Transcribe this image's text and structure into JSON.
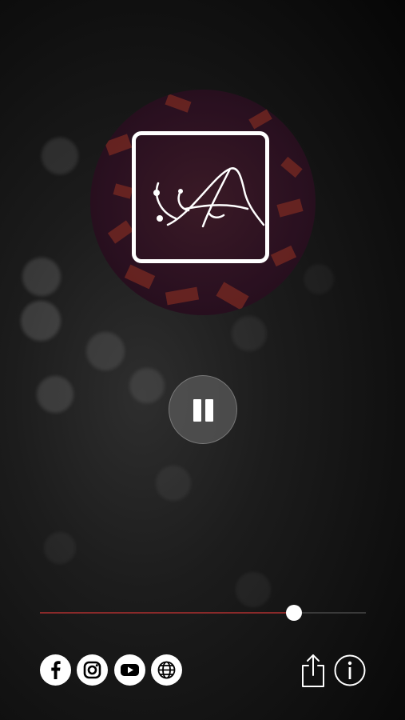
{
  "player": {
    "state": "playing",
    "control_icon": "pause-icon",
    "progress": 0.78
  },
  "artwork": {
    "logo_icon": "stylized-a-logo-icon"
  },
  "colors": {
    "progress_fill": "#8a2a2a",
    "progress_track": "#3a3a3a",
    "thumb": "#ffffff"
  },
  "social_links": [
    {
      "icon": "facebook-icon"
    },
    {
      "icon": "instagram-icon"
    },
    {
      "icon": "youtube-icon"
    },
    {
      "icon": "globe-icon"
    }
  ],
  "actions": [
    {
      "icon": "share-icon"
    },
    {
      "icon": "info-icon"
    }
  ]
}
